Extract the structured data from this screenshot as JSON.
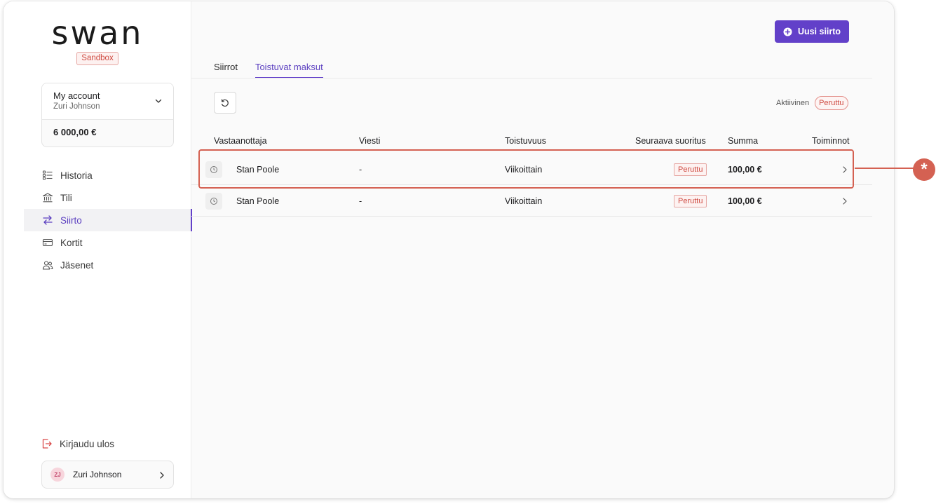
{
  "brand": {
    "logo": "swan",
    "env_badge": "Sandbox"
  },
  "account": {
    "name": "My account",
    "holder": "Zuri Johnson",
    "balance": "6 000,00 €"
  },
  "nav": {
    "items": [
      {
        "label": "Historia",
        "icon": "list-icon"
      },
      {
        "label": "Tili",
        "icon": "bank-icon"
      },
      {
        "label": "Siirto",
        "icon": "transfer-arrows-icon",
        "active": true
      },
      {
        "label": "Kortit",
        "icon": "card-icon"
      },
      {
        "label": "Jäsenet",
        "icon": "members-icon"
      }
    ],
    "logout": "Kirjaudu ulos"
  },
  "user": {
    "initials": "ZJ",
    "name": "Zuri Johnson"
  },
  "header": {
    "new_transfer": "Uusi siirto"
  },
  "tabs": [
    {
      "label": "Siirrot"
    },
    {
      "label": "Toistuvat maksut",
      "active": true
    }
  ],
  "filter": {
    "options": [
      "Aktiivinen",
      "Peruttu"
    ],
    "selected": "Peruttu"
  },
  "table": {
    "columns": {
      "recipient": "Vastaanottaja",
      "message": "Viesti",
      "frequency": "Toistuvuus",
      "next": "Seuraava suoritus",
      "amount": "Summa",
      "actions": "Toiminnot"
    },
    "rows": [
      {
        "recipient": "Stan Poole",
        "message": "-",
        "frequency": "Viikoittain",
        "status": "Peruttu",
        "amount": "100,00 €"
      },
      {
        "recipient": "Stan Poole",
        "message": "-",
        "frequency": "Viikoittain",
        "status": "Peruttu",
        "amount": "100,00 €"
      }
    ]
  },
  "annotation": {
    "marker": "*"
  },
  "colors": {
    "accent": "#6240c9",
    "danger": "#cf4a41",
    "annotation": "#d46152"
  }
}
